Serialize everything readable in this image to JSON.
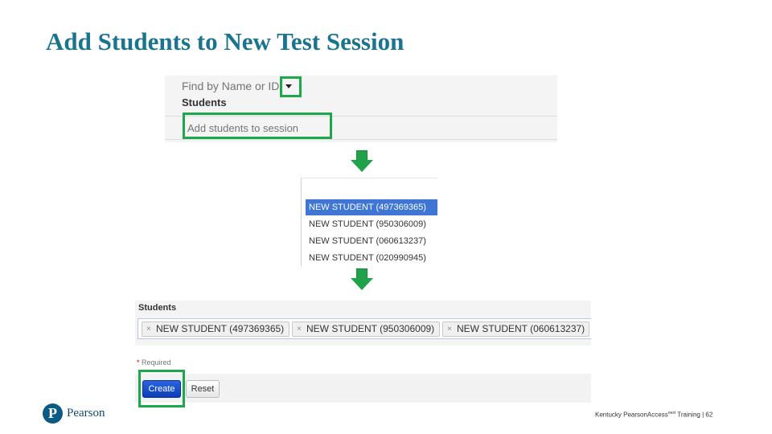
{
  "slide": {
    "title": "Add Students to New Test Session"
  },
  "step1": {
    "find_label": "Find by Name or ID",
    "students_label": "Students",
    "input_placeholder": "Add students to session"
  },
  "dropdown": {
    "items": [
      {
        "label": "NEW STUDENT (497369365)",
        "selected": true
      },
      {
        "label": "NEW STUDENT (950306009)",
        "selected": false
      },
      {
        "label": "NEW STUDENT (060613237)",
        "selected": false
      },
      {
        "label": "NEW STUDENT (020990945)",
        "selected": false
      }
    ]
  },
  "step3": {
    "students_label": "Students",
    "tags": [
      {
        "label": "NEW STUDENT (497369365)"
      },
      {
        "label": "NEW STUDENT (950306009)"
      },
      {
        "label": "NEW STUDENT (060613237)"
      }
    ],
    "remove_glyph": "×",
    "required_star": "*",
    "required_label": " Required",
    "create_label": "Create",
    "reset_label": "Reset"
  },
  "footer": {
    "logo_mark": "P",
    "logo_text": "Pearson",
    "text_pre": "Kentucky PearsonAccess",
    "text_sup": "next",
    "text_post": " Training | 62"
  },
  "colors": {
    "title": "#1a7490",
    "highlight": "#1aa84b",
    "arrow": "#1fa24a",
    "selected": "#3f75d4",
    "create_button": "#0b3fb8"
  }
}
